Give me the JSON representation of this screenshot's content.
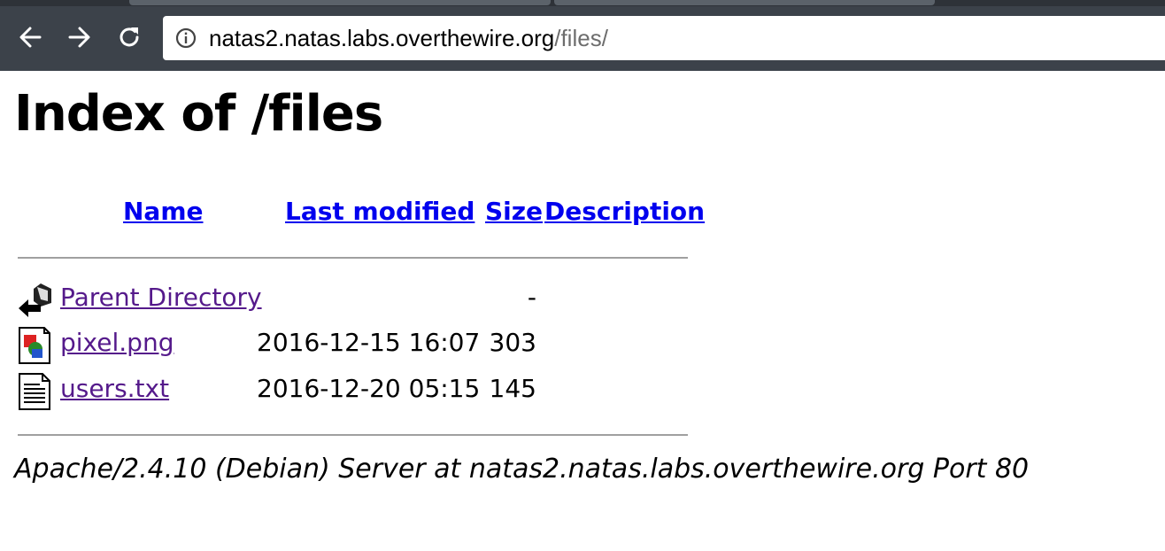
{
  "browser": {
    "url_host": "natas2.natas.labs.overthewire.org",
    "url_path": "/files/"
  },
  "page": {
    "title": "Index of /files",
    "columns": {
      "name": "Name",
      "last_modified": "Last modified",
      "size": "Size",
      "description": "Description"
    },
    "rows": [
      {
        "icon": "back-icon",
        "name": "Parent Directory",
        "last_modified": "",
        "size": "-",
        "description": ""
      },
      {
        "icon": "image-file-icon",
        "name": "pixel.png",
        "last_modified": "2016-12-15 16:07",
        "size": "303",
        "description": ""
      },
      {
        "icon": "text-file-icon",
        "name": "users.txt",
        "last_modified": "2016-12-20 05:15",
        "size": "145",
        "description": ""
      }
    ],
    "footer": "Apache/2.4.10 (Debian) Server at natas2.natas.labs.overthewire.org Port 80"
  },
  "colors": {
    "link": "#0000ee",
    "visited_link": "#551a8b",
    "chrome_bg": "#3c424a"
  }
}
